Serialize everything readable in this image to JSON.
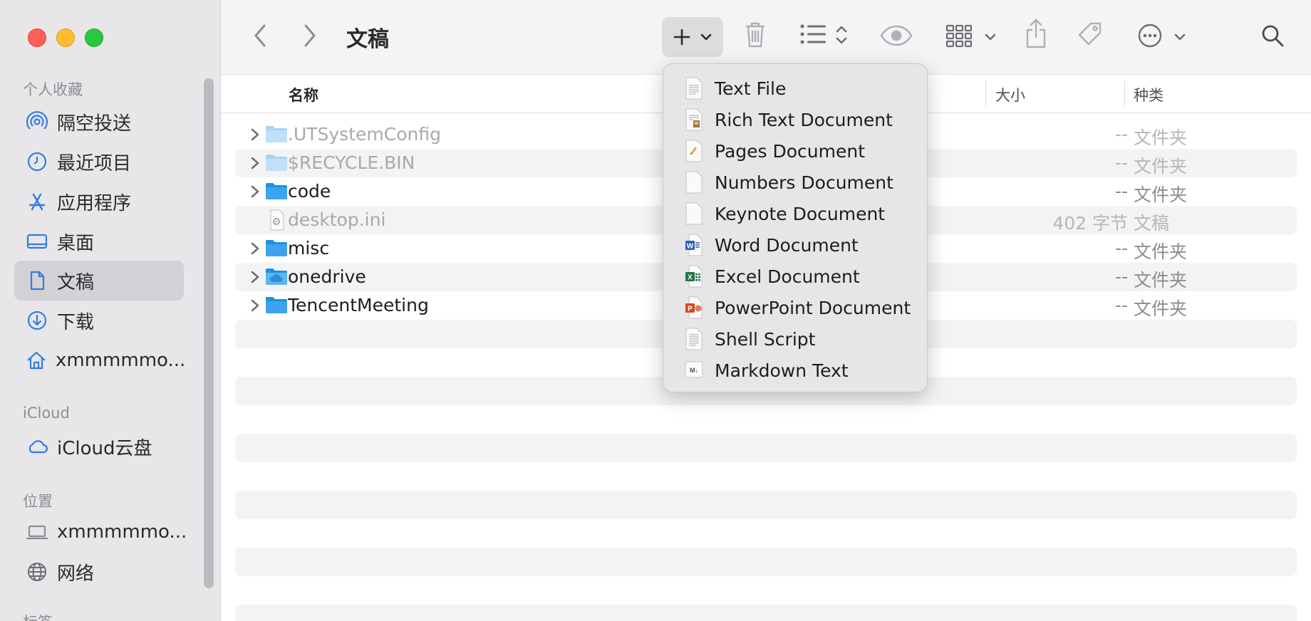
{
  "window": {
    "title": "文稿"
  },
  "sidebar": {
    "favorites_header": "个人收藏",
    "favorites": [
      {
        "label": "隔空投送",
        "icon": "airdrop-icon"
      },
      {
        "label": "最近项目",
        "icon": "clock-icon"
      },
      {
        "label": "应用程序",
        "icon": "applications-icon"
      },
      {
        "label": "桌面",
        "icon": "desktop-icon"
      },
      {
        "label": "文稿",
        "icon": "document-icon",
        "selected": true
      },
      {
        "label": "下载",
        "icon": "download-icon"
      },
      {
        "label": "xmmmmmo...",
        "icon": "home-icon"
      }
    ],
    "icloud_header": "iCloud",
    "icloud": [
      {
        "label": "iCloud云盘",
        "icon": "cloud-icon"
      }
    ],
    "locations_header": "位置",
    "locations": [
      {
        "label": "xmmmmmo...",
        "icon": "laptop-icon"
      },
      {
        "label": "网络",
        "icon": "globe-icon"
      }
    ],
    "tags_header": "标签"
  },
  "columns": {
    "name": "名称",
    "size": "大小",
    "kind": "种类"
  },
  "files": [
    {
      "name": ".UTSystemConfig",
      "size": "--",
      "kind": "文件夹",
      "type": "folder",
      "dimmed": true
    },
    {
      "name": "$RECYCLE.BIN",
      "size": "--",
      "kind": "文件夹",
      "type": "folder",
      "dimmed": true
    },
    {
      "name": "code",
      "size": "--",
      "kind": "文件夹",
      "type": "folder",
      "dimmed": false
    },
    {
      "name": "desktop.ini",
      "size": "402 字节",
      "kind": "文稿",
      "type": "file",
      "dimmed": true
    },
    {
      "name": "misc",
      "size": "--",
      "kind": "文件夹",
      "type": "folder",
      "dimmed": false
    },
    {
      "name": "onedrive",
      "size": "--",
      "kind": "文件夹",
      "type": "cloud-folder",
      "dimmed": false
    },
    {
      "name": "TencentMeeting",
      "size": "--",
      "kind": "文件夹",
      "type": "folder",
      "dimmed": false
    }
  ],
  "new_menu": {
    "items": [
      {
        "label": "Text File",
        "icon": "text-file-icon"
      },
      {
        "label": "Rich Text Document",
        "icon": "rich-text-icon"
      },
      {
        "label": "Pages Document",
        "icon": "pages-icon"
      },
      {
        "label": "Numbers Document",
        "icon": "numbers-icon"
      },
      {
        "label": "Keynote Document",
        "icon": "keynote-icon"
      },
      {
        "label": "Word Document",
        "icon": "word-icon"
      },
      {
        "label": "Excel Document",
        "icon": "excel-icon"
      },
      {
        "label": "PowerPoint Document",
        "icon": "powerpoint-icon"
      },
      {
        "label": "Shell Script",
        "icon": "shell-script-icon"
      },
      {
        "label": "Markdown Text",
        "icon": "markdown-icon"
      }
    ]
  },
  "colors": {
    "accent": "#2f7de1",
    "folder": "#3ea3ee",
    "word": "#2b5fbd",
    "excel": "#207245",
    "powerpoint": "#d24726"
  }
}
